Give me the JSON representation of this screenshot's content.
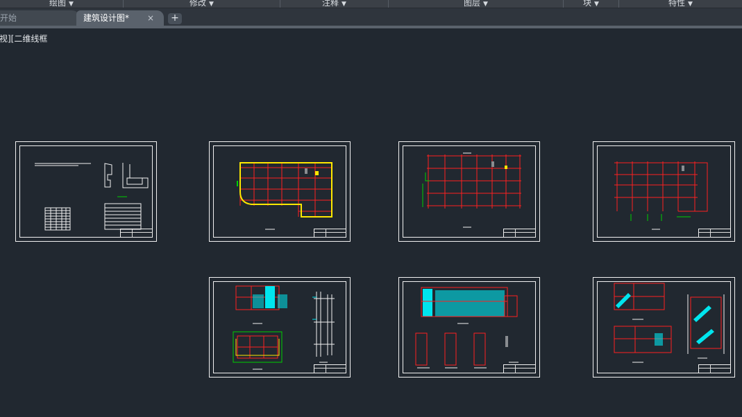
{
  "ribbon": {
    "panels": [
      {
        "label": "绘图"
      },
      {
        "label": "修改"
      },
      {
        "label": "注释"
      },
      {
        "label": "图层"
      },
      {
        "label": "块"
      },
      {
        "label": "特性"
      }
    ]
  },
  "tabs": {
    "start": "开始",
    "active": "建筑设计图*",
    "close": "×",
    "add": "+"
  },
  "viewport": {
    "label": "视][二维线框"
  },
  "colors": {
    "background": "#212830",
    "grid": "#ff2020",
    "wall": "#ffe800",
    "cyan": "#00e5ee",
    "green": "#00d000",
    "sheet": "#f2f2f2"
  },
  "sheets": [
    {
      "name": "cover-notes-sheet"
    },
    {
      "name": "first-floor-plan-sheet"
    },
    {
      "name": "second-floor-plan-sheet"
    },
    {
      "name": "third-floor-plan-sheet"
    },
    {
      "name": "elevation-detail-sheet"
    },
    {
      "name": "front-elevation-sheet"
    },
    {
      "name": "section-stair-sheet"
    }
  ]
}
